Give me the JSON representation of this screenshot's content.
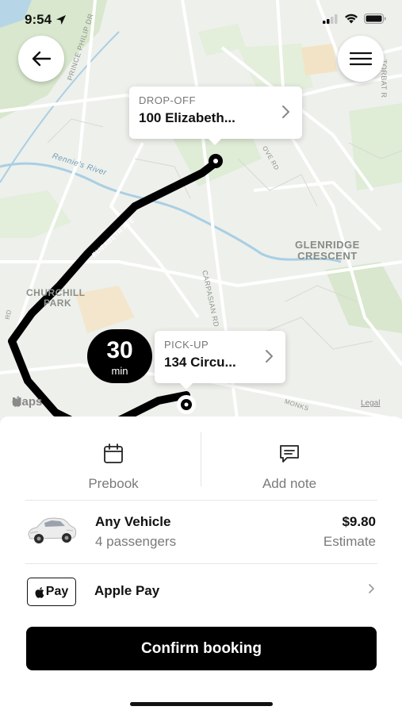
{
  "status_bar": {
    "time": "9:54"
  },
  "map": {
    "labels": {
      "glenridge_line1": "GLENRIDGE",
      "glenridge_line2": "CRESCENT",
      "churchill_line1": "CHURCHILL",
      "churchill_line2": "PARK",
      "prince_philip": "PRINCE PHILIP DR",
      "carpasian": "CARPASIAN RD",
      "river": "Rennie's River",
      "elizabeth": "ELIZABETH AVE",
      "torbay": "TORBAT R",
      "grove": "OVE RD",
      "monks": "MONKS",
      "rd": "RD"
    },
    "maps_logo": "Maps",
    "legal": "Legal"
  },
  "dropoff": {
    "label": "DROP-OFF",
    "address": "100 Elizabeth..."
  },
  "pickup": {
    "label": "PICK-UP",
    "address": "134 Circu..."
  },
  "eta": {
    "value": "30",
    "unit": "min"
  },
  "actions": {
    "prebook": "Prebook",
    "add_note": "Add note"
  },
  "vehicle": {
    "name": "Any Vehicle",
    "passengers": "4 passengers",
    "price": "$9.80",
    "price_note": "Estimate"
  },
  "payment": {
    "badge_text": "Pay",
    "method": "Apple Pay"
  },
  "confirm": {
    "label": "Confirm booking"
  },
  "colors": {
    "route": "#000000",
    "map_background": "#eef0ec",
    "park_green": "#d9e8cf",
    "river_blue": "#a9cfe3"
  }
}
